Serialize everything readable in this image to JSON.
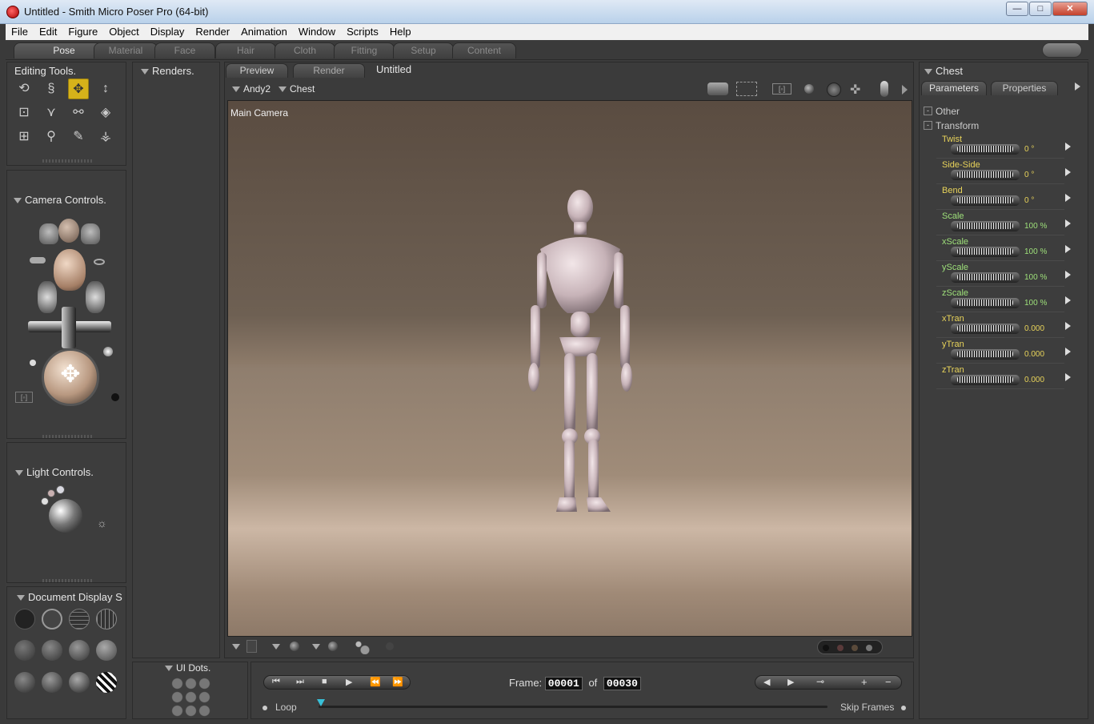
{
  "window": {
    "title": "Untitled - Smith Micro Poser Pro  (64-bit)",
    "buttons": {
      "minimize": "—",
      "maximize": "□",
      "close": "✕"
    }
  },
  "menu": [
    "File",
    "Edit",
    "Figure",
    "Object",
    "Display",
    "Render",
    "Animation",
    "Window",
    "Scripts",
    "Help"
  ],
  "rooms": [
    {
      "label": "Pose",
      "active": true
    },
    {
      "label": "Material"
    },
    {
      "label": "Face"
    },
    {
      "label": "Hair"
    },
    {
      "label": "Cloth"
    },
    {
      "label": "Fitting"
    },
    {
      "label": "Setup"
    },
    {
      "label": "Content"
    }
  ],
  "editing_tools": {
    "title": "Editing Tools."
  },
  "renders": {
    "title": "Renders."
  },
  "camera_controls": {
    "title": "Camera Controls."
  },
  "light_controls": {
    "title": "Light Controls."
  },
  "document_display": {
    "title": "Document Display S"
  },
  "ui_dots": {
    "title": "UI Dots."
  },
  "document": {
    "tabs": [
      "Preview",
      "Render"
    ],
    "doc_title": "Untitled",
    "figure": "Andy2",
    "actor": "Chest",
    "camera_label": "Main Camera"
  },
  "parameters": {
    "title": "Chest",
    "tabs": [
      "Parameters",
      "Properties"
    ],
    "groups": [
      {
        "label": "Other",
        "toggle": "-"
      },
      {
        "label": "Transform",
        "toggle": "-"
      }
    ],
    "items": [
      {
        "name": "Twist",
        "value": "0 °",
        "kind": "rot"
      },
      {
        "name": "Side-Side",
        "value": "0 °",
        "kind": "rot"
      },
      {
        "name": "Bend",
        "value": "0 °",
        "kind": "rot"
      },
      {
        "name": "Scale",
        "value": "100 %",
        "kind": "scale"
      },
      {
        "name": "xScale",
        "value": "100 %",
        "kind": "scale"
      },
      {
        "name": "yScale",
        "value": "100 %",
        "kind": "scale"
      },
      {
        "name": "zScale",
        "value": "100 %",
        "kind": "scale"
      },
      {
        "name": "xTran",
        "value": "0.000",
        "kind": "tran"
      },
      {
        "name": "yTran",
        "value": "0.000",
        "kind": "tran"
      },
      {
        "name": "zTran",
        "value": "0.000",
        "kind": "tran"
      }
    ]
  },
  "animation": {
    "frame_label": "Frame:",
    "frame": "00001",
    "of_label": "of",
    "total": "00030",
    "loop_label": "Loop",
    "skip_label": "Skip Frames",
    "transport": [
      "⏮",
      "⏭",
      "■",
      "▶",
      "⏪",
      "⏩"
    ],
    "keys": [
      "◀",
      "▶",
      "⊸",
      "+",
      "−"
    ]
  },
  "colors": {
    "accent": "#d6b21a",
    "param_yellow": "#e8d35a",
    "param_green": "#9ee07a"
  }
}
